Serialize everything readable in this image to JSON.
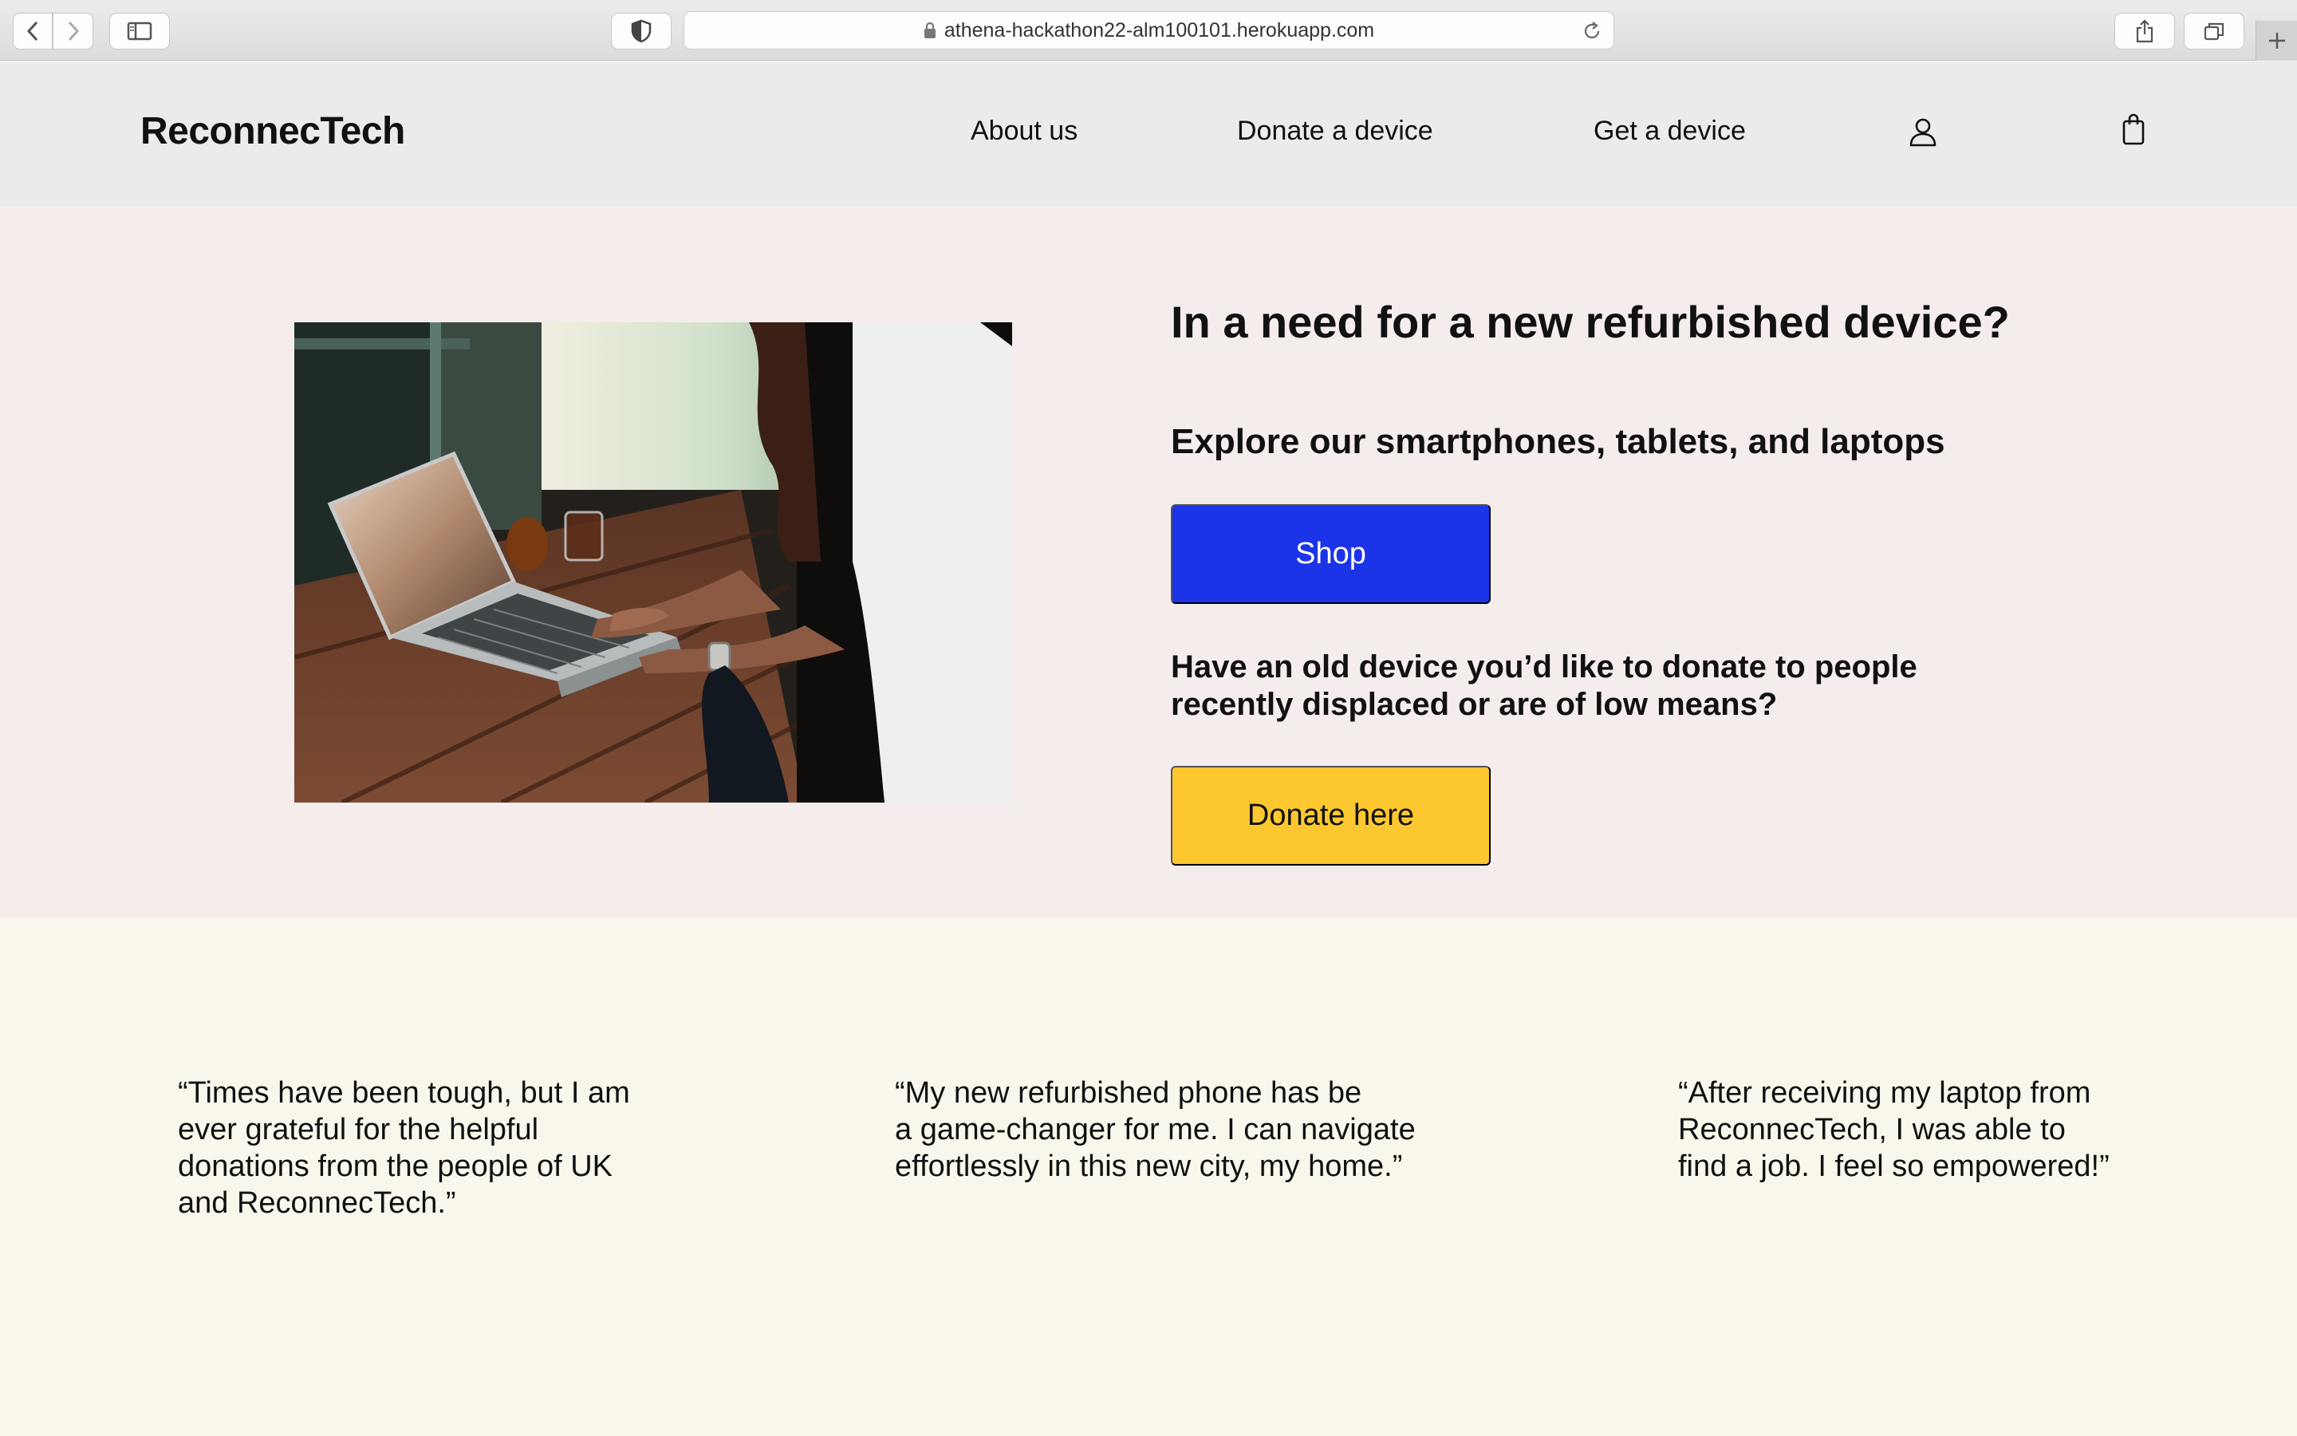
{
  "browser": {
    "url": "athena-hackathon22-alm100101.herokuapp.com"
  },
  "header": {
    "brand": "ReconnecTech",
    "nav": {
      "about": "About us",
      "donate": "Donate a device",
      "get": "Get a device"
    },
    "icons": [
      "user-icon",
      "shopping-bag-icon"
    ]
  },
  "hero": {
    "title": "In a need for a new refurbished device?",
    "subtitle": "Explore our smartphones, tablets, and laptops",
    "shop_label": "Shop",
    "question": "Have an old device you’d like to donate to people recently displaced or are of low means?",
    "donate_label": "Donate here"
  },
  "testimonials": [
    {
      "text": "“Times have been tough, but I am\never grateful for the helpful\ndonations from the people of UK\nand ReconnecTech.”"
    },
    {
      "text": "“My new refurbished phone has be\na game-changer for me. I can navigate\neffortlessly in this new city, my home.”"
    },
    {
      "text": "“After receiving my laptop from\nReconnecTech, I was able to\nfind a job. I feel so empowered!”"
    }
  ],
  "colors": {
    "header_bg": "#ebebea",
    "hero_bg": "#f5ecec",
    "testimonial_bg": "#f9f7ec",
    "shop_button": "#1c34e8",
    "donate_button": "#fcc72f"
  }
}
